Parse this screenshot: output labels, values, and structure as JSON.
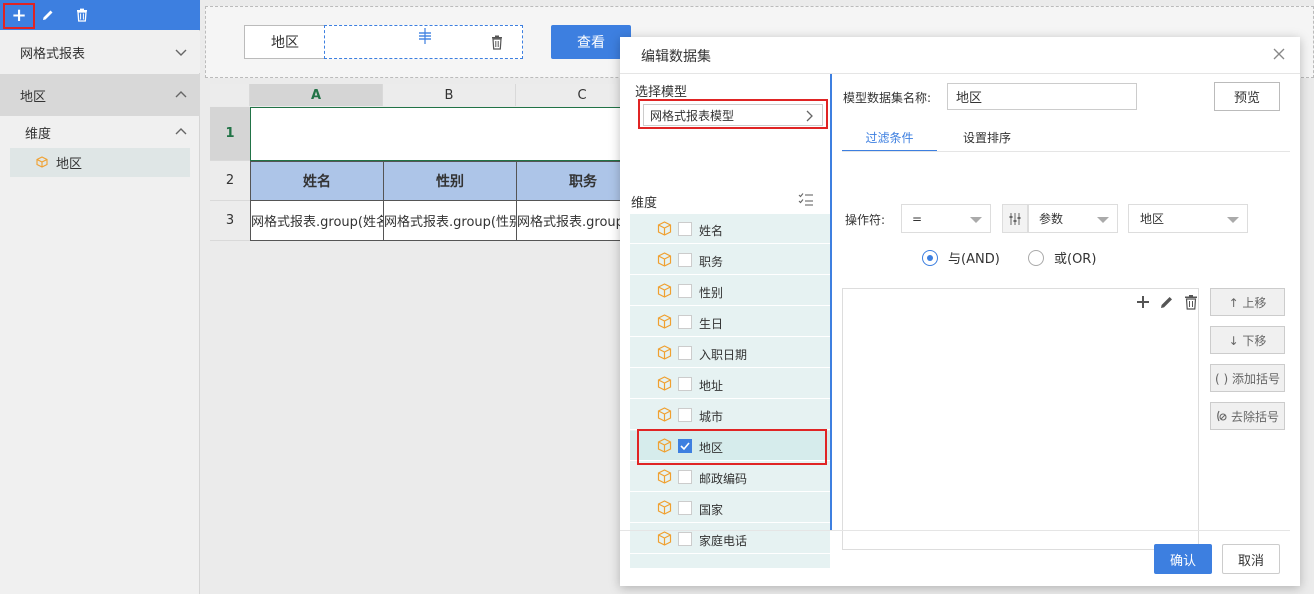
{
  "sidebar": {
    "toolbar": {
      "add_glyph": "+",
      "edit_icon": "pencil-icon",
      "delete_icon": "trash-icon"
    },
    "items": [
      {
        "label": "网格式报表"
      },
      {
        "label": "地区"
      },
      {
        "label": "维度"
      },
      {
        "label": "地区"
      }
    ]
  },
  "params": {
    "label": "地区",
    "query_button": "查看"
  },
  "sheet": {
    "columns": [
      "A",
      "B",
      "C"
    ],
    "rows": [
      "1",
      "2",
      "3"
    ],
    "headers": [
      "姓名",
      "性别",
      "职务"
    ],
    "cells": [
      "网格式报表.group(姓名",
      "网格式报表.group(性别",
      "网格式报表.group("
    ]
  },
  "dialog": {
    "title": "编辑数据集",
    "choose_model_label": "选择模型",
    "model_value": "网格式报表模型",
    "dimension_label": "维度",
    "dimensions": [
      {
        "label": "姓名",
        "checked": false
      },
      {
        "label": "职务",
        "checked": false
      },
      {
        "label": "性别",
        "checked": false
      },
      {
        "label": "生日",
        "checked": false
      },
      {
        "label": "入职日期",
        "checked": false
      },
      {
        "label": "地址",
        "checked": false
      },
      {
        "label": "城市",
        "checked": false
      },
      {
        "label": "地区",
        "checked": true
      },
      {
        "label": "邮政编码",
        "checked": false
      },
      {
        "label": "国家",
        "checked": false
      },
      {
        "label": "家庭电话",
        "checked": false
      }
    ],
    "dataset_name_label": "模型数据集名称:",
    "dataset_name_value": "地区",
    "preview_button": "预览",
    "tabs": [
      "过滤条件",
      "设置排序"
    ],
    "operator_label": "操作符:",
    "operator_value": "=",
    "type_value": "参数",
    "param_value": "地区",
    "radio_and": "与(AND)",
    "radio_or": "或(OR)",
    "side_buttons": {
      "up": "↑ 上移",
      "down": "↓ 下移",
      "add_bracket": "( ) 添加括号",
      "remove_bracket": "去除括号"
    },
    "ok_button": "确认",
    "cancel_button": "取消"
  },
  "colors": {
    "accent": "#3d7fe0",
    "highlight_red": "#e02424",
    "header_fill": "#adc5e8",
    "cube_orange": "#f0a030"
  }
}
